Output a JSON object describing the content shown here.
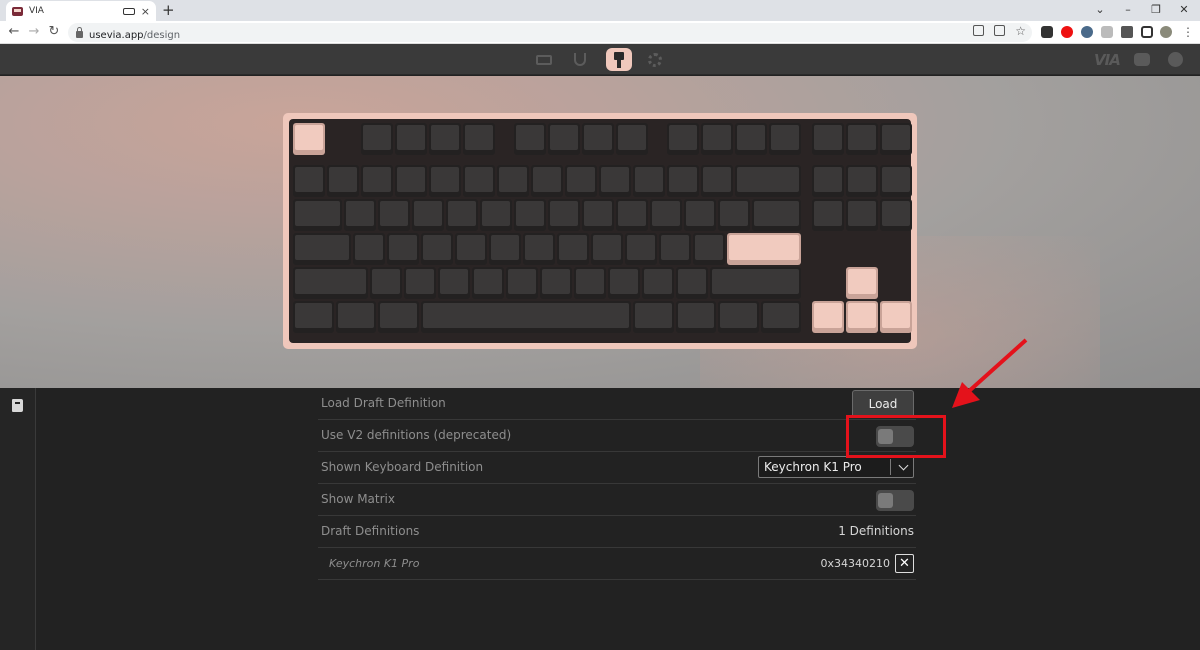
{
  "browser": {
    "tab_title": "VIA",
    "tab_close": "×",
    "new_tab": "+",
    "url_host": "usevia.app",
    "url_path": "/design",
    "back": "←",
    "forward": "→",
    "reload": "↻",
    "bookmark_star": "☆",
    "window_minimize": "⌄",
    "window_min": "–",
    "window_restore": "❐",
    "window_close": "✕"
  },
  "app": {
    "logo": "VIA",
    "nav": [
      {
        "name": "configure",
        "icon": "keyboard-icon"
      },
      {
        "name": "test",
        "icon": "stethoscope-icon"
      },
      {
        "name": "design",
        "icon": "paintbrush-icon",
        "active": true
      },
      {
        "name": "settings",
        "icon": "gear-icon"
      }
    ],
    "accent_color": "#f0c8bc"
  },
  "settings": {
    "load_draft": {
      "label": "Load Draft Definition",
      "button": "Load"
    },
    "use_v2": {
      "label": "Use V2 definitions (deprecated)",
      "enabled": false
    },
    "shown_keyboard": {
      "label": "Shown Keyboard Definition",
      "value": "Keychron K1 Pro"
    },
    "show_matrix": {
      "label": "Show Matrix",
      "enabled": false
    },
    "draft_definitions": {
      "label": "Draft Definitions",
      "count": "1 Definitions"
    },
    "definitions": [
      {
        "name": "Keychron K1 Pro",
        "id": "0x34340210",
        "remove": "✕"
      }
    ]
  },
  "annotation": {
    "color": "#e4121b",
    "target": "use-v2-toggle"
  }
}
